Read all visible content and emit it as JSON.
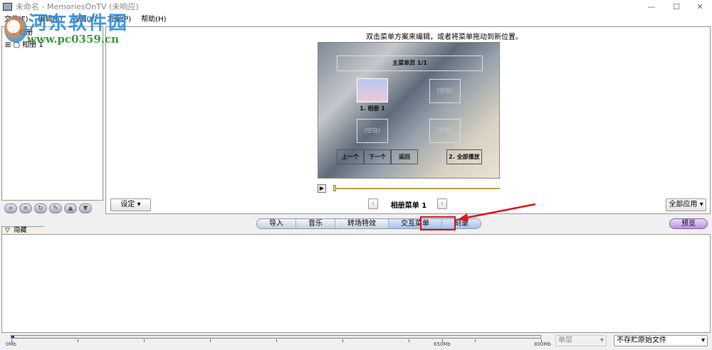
{
  "window": {
    "title": "未命名 - MemoriesOnTV (未响应)",
    "minimize": "—",
    "maximize": "☐",
    "close": "✕"
  },
  "menu": [
    "文件(F)",
    "编辑(E)",
    "视图(V)",
    "方案(P)",
    "帮助(H)"
  ],
  "watermark": {
    "name": "河东软件园",
    "url": "www.pc0359.cn"
  },
  "tree": {
    "root": "1 相册",
    "child": "相册 1",
    "expand": "⊞"
  },
  "tree_toolbar": [
    "+",
    "×",
    "↻",
    "✎",
    "▲",
    "▼"
  ],
  "editor": {
    "hint": "双击菜单方案来编辑，或者将菜单拖动到新位置。",
    "menu_title": "主菜单页 1/1",
    "items": [
      "1. 相册 1",
      "(空白)",
      "(空白)",
      "(空白)"
    ],
    "nav_buttons": [
      "上一个",
      "下一个",
      "返回"
    ],
    "play_all": "2. 全部播放",
    "settings_button": "设定",
    "menu_name": "相册菜单 1",
    "prev": "‹",
    "next": "›",
    "apply_all_button": "全部应用"
  },
  "tabs": [
    "导入",
    "音乐",
    "转场特效",
    "交互菜单",
    "刻录"
  ],
  "active_tab": "交互菜单",
  "preview_button": "预览",
  "hide_tab": "隐藏",
  "capacity": {
    "labels": [
      "0Mb",
      "650Mb",
      "800Mb"
    ],
    "used_fraction": 0.005
  },
  "layer_select": "单层",
  "store_select": "不存贮原始文件",
  "colors": {
    "highlight": "#e0141c",
    "accent": "#a8c0ea"
  }
}
